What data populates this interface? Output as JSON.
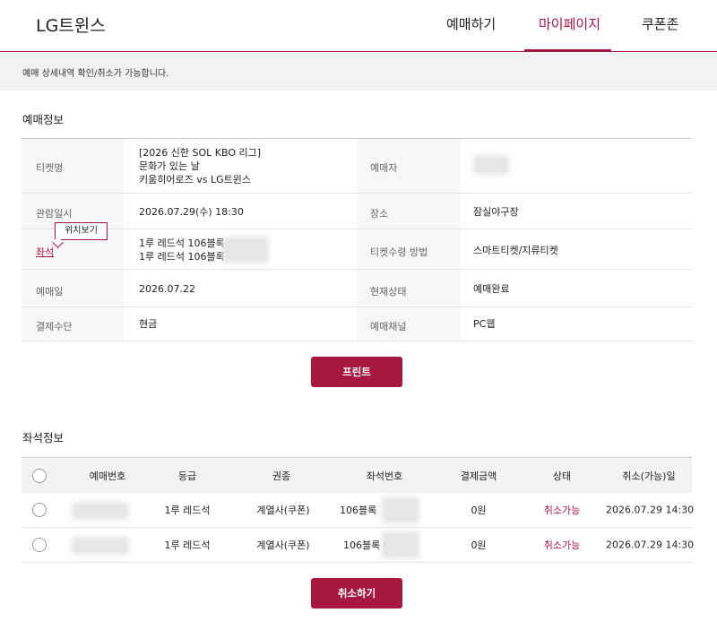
{
  "header": {
    "logo": "LG트윈스",
    "nav": [
      "예매하기",
      "마이페이지",
      "쿠폰존"
    ]
  },
  "notice": "예매 상세내역 확인/취소가 가능합니다.",
  "booking_info": {
    "title": "예매정보",
    "ticket_label": "티켓명",
    "ticket_lines": [
      "[2026 신한 SOL KBO 리그]",
      "문화가 있는 날",
      "키움히어로즈 vs LG트윈스"
    ],
    "booker_label": "예매자",
    "view_date_label": "관람일시",
    "view_date": "2026.07.29(수) 18:30",
    "venue_label": "장소",
    "venue": "잠실야구장",
    "seat_label": "좌석",
    "seat_tooltip": "위치보기",
    "seat_lines": [
      "1루 레드석 106블록",
      "1루 레드석 106블록"
    ],
    "receive_label": "티켓수령 방법",
    "receive": "스마트티켓/지류티켓",
    "reserve_date_label": "예매일",
    "reserve_date": "2026.07.22",
    "status_label": "현재상태",
    "status": "예매완료",
    "payment_label": "결제수단",
    "payment": "현금",
    "channel_label": "예매채널",
    "channel": "PC웹"
  },
  "print_button": "프린트",
  "seat_info": {
    "title": "좌석정보",
    "columns": [
      "예매번호",
      "등급",
      "권종",
      "좌석번호",
      "결제금액",
      "상태",
      "취소(가능)일"
    ],
    "rows": [
      {
        "grade": "1루 레드석",
        "type": "계열사(쿠폰)",
        "seat": "106블록",
        "amount": "0원",
        "status": "취소가능",
        "cancel_date": "2026.07.29 14:30"
      },
      {
        "grade": "1루 레드석",
        "type": "계열사(쿠폰)",
        "seat": "106블록 9",
        "amount": "0원",
        "status": "취소가능",
        "cancel_date": "2026.07.29 14:30"
      }
    ]
  },
  "cancel_button": "취소하기",
  "colors": {
    "accent": "#a8173f"
  }
}
